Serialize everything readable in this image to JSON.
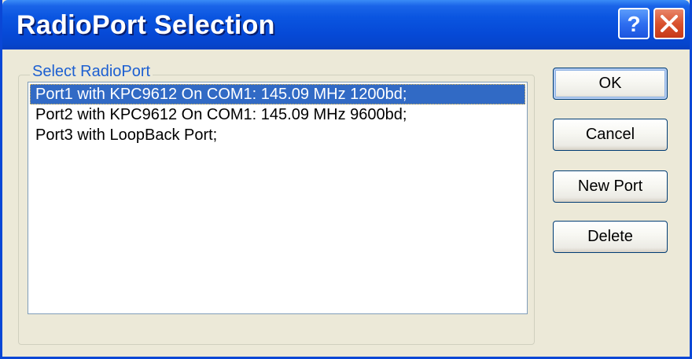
{
  "window": {
    "title": "RadioPort Selection"
  },
  "titlebar_buttons": {
    "help_icon": "help-question-icon",
    "close_icon": "close-x-icon"
  },
  "group": {
    "label": "Select RadioPort"
  },
  "ports": {
    "items": [
      "Port1 with KPC9612 On COM1: 145.09 MHz 1200bd;",
      "Port2 with KPC9612 On COM1: 145.09  MHz 9600bd;",
      "Port3 with LoopBack Port;"
    ],
    "selected_index": 0
  },
  "buttons": {
    "ok": "OK",
    "cancel": "Cancel",
    "new_port": "New Port",
    "delete": "Delete"
  },
  "colors": {
    "titlebar": "#0649d6",
    "selection": "#316ac5",
    "group_label": "#1c5fd1",
    "dialog_bg": "#ece9d8",
    "close_button": "#d9522e"
  }
}
